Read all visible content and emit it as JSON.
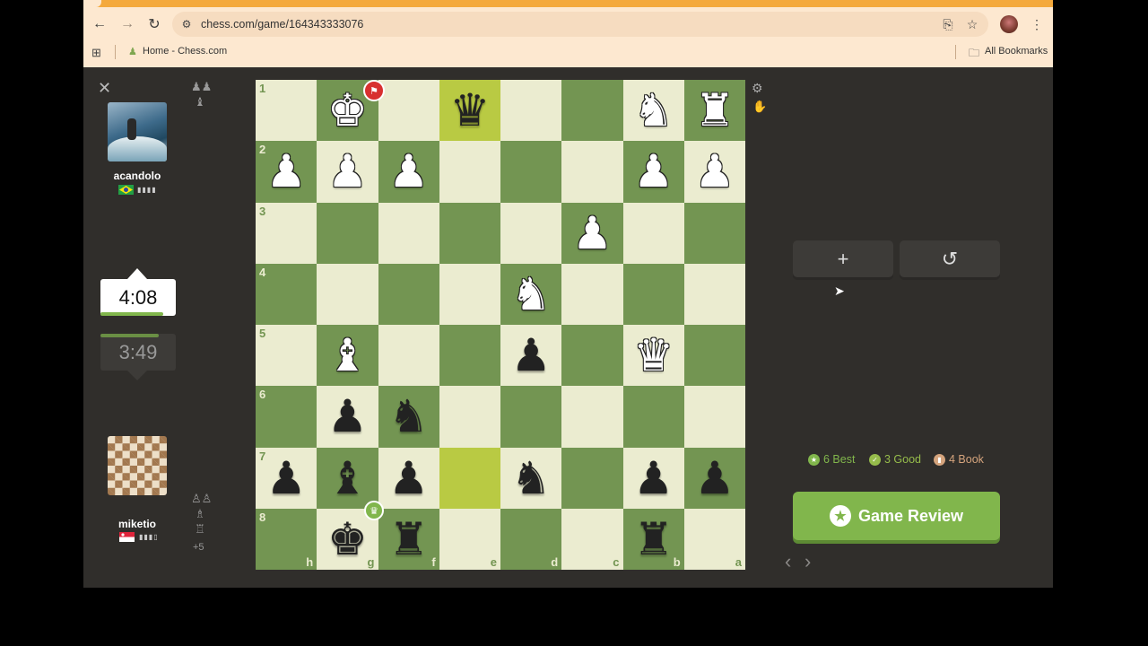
{
  "browser": {
    "url": "chess.com/game/164343333076",
    "bookmark_home": "Home - Chess.com",
    "bookmark_all": "All Bookmarks",
    "icons": [
      "back-icon",
      "forward-icon",
      "reload-icon",
      "site-settings-icon",
      "install-icon",
      "star-icon",
      "profile-avatar",
      "menu-icon"
    ]
  },
  "players": {
    "top": {
      "name": "acandolo",
      "clock": "4:08",
      "country": "Brazil"
    },
    "bottom": {
      "name": "miketio",
      "clock": "3:49",
      "country": "Singapore",
      "material": "+5"
    }
  },
  "board": {
    "ranks": [
      "1",
      "2",
      "3",
      "4",
      "5",
      "6",
      "7",
      "8"
    ],
    "files": [
      "h",
      "g",
      "f",
      "e",
      "d",
      "c",
      "b",
      "a"
    ],
    "orientation": "black-bottom",
    "highlighted": [
      "e1",
      "e7"
    ],
    "pieces": [
      {
        "sq": "g1",
        "p": "♚",
        "c": "w"
      },
      {
        "sq": "e1",
        "p": "♛",
        "c": "b"
      },
      {
        "sq": "b1",
        "p": "♞",
        "c": "w"
      },
      {
        "sq": "a1",
        "p": "♜",
        "c": "w"
      },
      {
        "sq": "h2",
        "p": "♟",
        "c": "w"
      },
      {
        "sq": "g2",
        "p": "♟",
        "c": "w"
      },
      {
        "sq": "f2",
        "p": "♟",
        "c": "w"
      },
      {
        "sq": "b2",
        "p": "♟",
        "c": "w"
      },
      {
        "sq": "a2",
        "p": "♟",
        "c": "w"
      },
      {
        "sq": "c3",
        "p": "♟",
        "c": "w"
      },
      {
        "sq": "d4",
        "p": "♞",
        "c": "w"
      },
      {
        "sq": "g5",
        "p": "♝",
        "c": "w"
      },
      {
        "sq": "d5",
        "p": "♟",
        "c": "b"
      },
      {
        "sq": "b5",
        "p": "♛",
        "c": "w"
      },
      {
        "sq": "g6",
        "p": "♟",
        "c": "b"
      },
      {
        "sq": "f6",
        "p": "♞",
        "c": "b"
      },
      {
        "sq": "h7",
        "p": "♟",
        "c": "b"
      },
      {
        "sq": "g7",
        "p": "♝",
        "c": "b"
      },
      {
        "sq": "f7",
        "p": "♟",
        "c": "b"
      },
      {
        "sq": "d7",
        "p": "♞",
        "c": "b"
      },
      {
        "sq": "b7",
        "p": "♟",
        "c": "b"
      },
      {
        "sq": "a7",
        "p": "♟",
        "c": "b"
      },
      {
        "sq": "g8",
        "p": "♚",
        "c": "b"
      },
      {
        "sq": "f8",
        "p": "♜",
        "c": "b"
      },
      {
        "sq": "b8",
        "p": "♜",
        "c": "b"
      }
    ],
    "colors": {
      "light": "#ebecd0",
      "dark": "#739552",
      "highlight_light": "#f5f682",
      "highlight_dark": "#b9ca43"
    }
  },
  "stats": {
    "best": "6 Best",
    "good": "3 Good",
    "book": "4 Book",
    "best_color": "#81b64c",
    "good_color": "#96bc4b",
    "book_color": "#d5a47d"
  },
  "actions": {
    "new_game": "+",
    "rematch": "↺",
    "game_review": "Game Review"
  }
}
